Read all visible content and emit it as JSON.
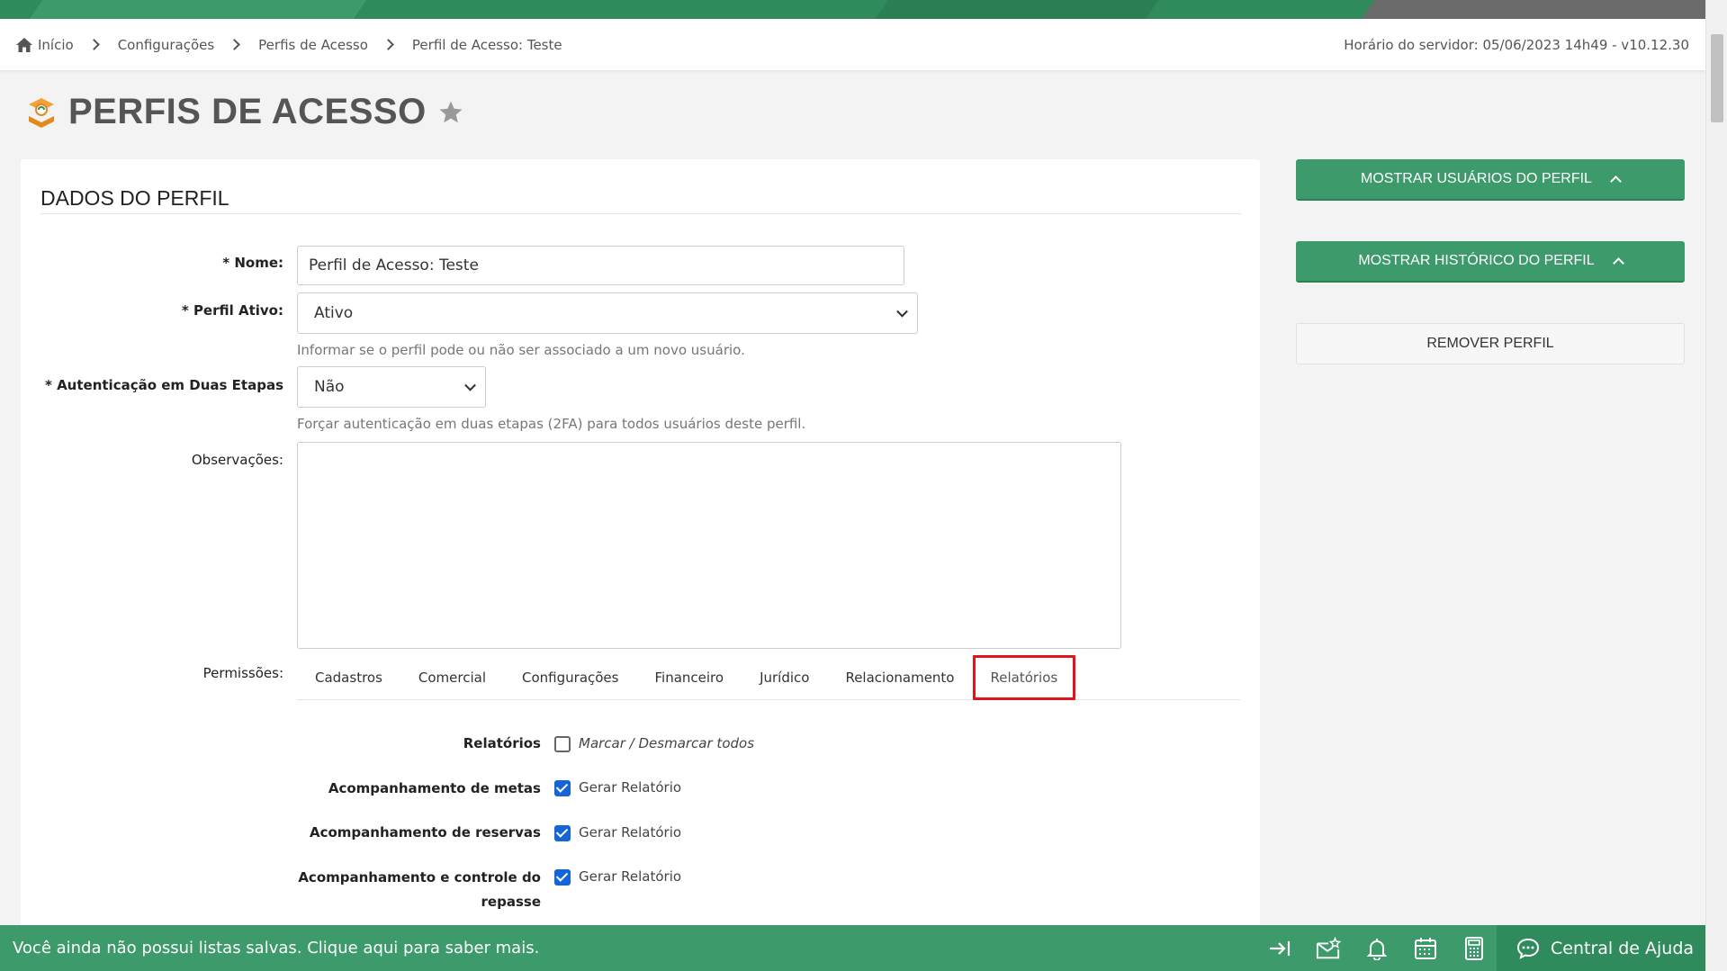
{
  "breadcrumb": {
    "items": [
      "Início",
      "Configurações",
      "Perfis de Acesso",
      "Perfil de Acesso: Teste"
    ],
    "server_time": "Horário do servidor: 05/06/2023 14h49 - v10.12.30"
  },
  "page": {
    "title": "PERFIS DE ACESSO"
  },
  "form": {
    "section_title": "DADOS DO PERFIL",
    "nome_label": "* Nome:",
    "nome_value": "Perfil de Acesso: Teste",
    "ativo_label": "* Perfil Ativo:",
    "ativo_value": "Ativo",
    "ativo_hint": "Informar se o perfil pode ou não ser associado a um novo usuário.",
    "twofa_label": "* Autenticação em Duas Etapas",
    "twofa_value": "Não",
    "twofa_hint": "Forçar autenticação em duas etapas (2FA) para todos usuários deste perfil.",
    "obs_label": "Observações:",
    "obs_value": "",
    "perm_label": "Permissões:"
  },
  "tabs": [
    "Cadastros",
    "Comercial",
    "Configurações",
    "Financeiro",
    "Jurídico",
    "Relacionamento",
    "Relatórios"
  ],
  "active_tab": "Relatórios",
  "permissions": {
    "group_label": "Relatórios",
    "toggle_all": "Marcar / Desmarcar todos",
    "rows": [
      {
        "label": "Acompanhamento de metas",
        "option": "Gerar Relatório",
        "checked": true
      },
      {
        "label": "Acompanhamento de reservas",
        "option": "Gerar Relatório",
        "checked": true
      },
      {
        "label_line1": "Acompanhamento e controle do",
        "label_line2": "repasse",
        "option": "Gerar Relatório",
        "checked": true
      }
    ]
  },
  "sidebar": {
    "show_users": "MOSTRAR USUÁRIOS DO PERFIL",
    "show_history": "MOSTRAR HISTÓRICO DO PERFIL",
    "remove": "REMOVER PERFIL"
  },
  "footer": {
    "message": "Você ainda não possui listas salvas. Clique aqui para saber mais.",
    "help": "Central de Ajuda",
    "icons": [
      "exit-icon",
      "mail-star-icon",
      "bell-icon",
      "calendar-icon",
      "calculator-icon",
      "chat-icon"
    ]
  },
  "colors": {
    "brand_green": "#3d9a6b",
    "dark_green": "#2f8a5c",
    "highlight_red": "#e3131b",
    "checkbox_blue": "#1565d8"
  }
}
